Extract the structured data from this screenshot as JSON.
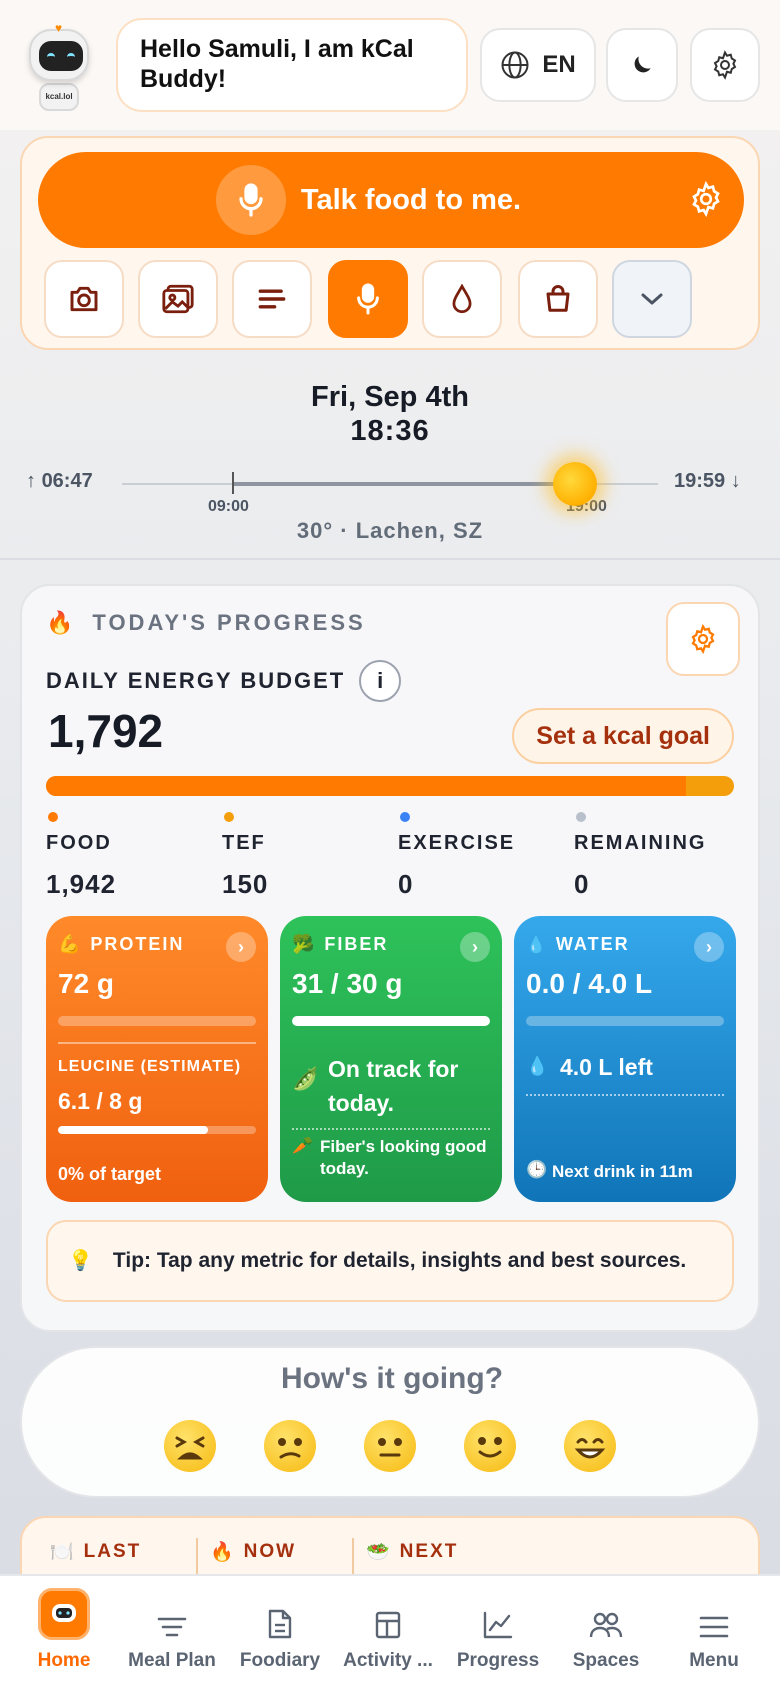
{
  "header": {
    "greeting": "Hello Samuli, I am kCal Buddy!",
    "avatar_badge": "kcal.lol",
    "language": "EN"
  },
  "talk": {
    "label": "Talk food to me.",
    "quick_actions": [
      "camera-icon",
      "gallery-icon",
      "text-lines-icon",
      "microphone-icon",
      "water-drop-icon",
      "shopping-bag-icon",
      "chevron-down-icon"
    ]
  },
  "time": {
    "date": "Fri, Sep 4th",
    "clock": "18:36",
    "sunrise": "06:47",
    "sunset": "19:59",
    "tick_start": "09:00",
    "tick_end": "19:00",
    "weather": "30° · Lachen, SZ"
  },
  "progress": {
    "section_title": "TODAY'S PROGRESS",
    "budget_label": "DAILY ENERGY BUDGET",
    "info_glyph": "i",
    "budget_value": "1,792",
    "goal_button": "Set a kcal goal",
    "food_fraction": 0.93,
    "stats": [
      {
        "label": "FOOD",
        "value": "1,942",
        "color": "#ff7a00"
      },
      {
        "label": "TEF",
        "value": "150",
        "color": "#f59e0b"
      },
      {
        "label": "EXERCISE",
        "value": "0",
        "color": "#3b82f6"
      },
      {
        "label": "REMAINING",
        "value": "0",
        "color": "#b8c0cc"
      }
    ],
    "protein": {
      "title": "PROTEIN",
      "value": "72 g",
      "fill": 0.0,
      "leucine_label": "LEUCINE (ESTIMATE)",
      "leucine_value": "6.1 / 8 g",
      "leucine_fill": 0.76,
      "target_text": "0% of target"
    },
    "fiber": {
      "title": "FIBER",
      "value": "31 / 30 g",
      "fill": 1.0,
      "status": "On track for today.",
      "footer": "Fiber's looking good today."
    },
    "water": {
      "title": "WATER",
      "value": "0.0 / 4.0 L",
      "fill": 0.0,
      "left": "4.0 L left",
      "footer": "Next drink in 11m"
    },
    "tip": "Tip: Tap any metric for details, insights and best sources."
  },
  "mood": {
    "question": "How's it going?",
    "faces": [
      "tired-face",
      "confused-face",
      "neutral-face",
      "slightly-smiling-face",
      "grinning-face"
    ]
  },
  "meals": {
    "last": "LAST",
    "now": "NOW",
    "next": "NEXT"
  },
  "nav": {
    "items": [
      "Home",
      "Meal Plan",
      "Foodiary",
      "Activity ...",
      "Progress",
      "Spaces",
      "Menu"
    ]
  },
  "colors": {
    "accent": "#ff7a00",
    "protein": "#f36a16",
    "fiber": "#27ae52",
    "water": "#1f8fd6"
  }
}
